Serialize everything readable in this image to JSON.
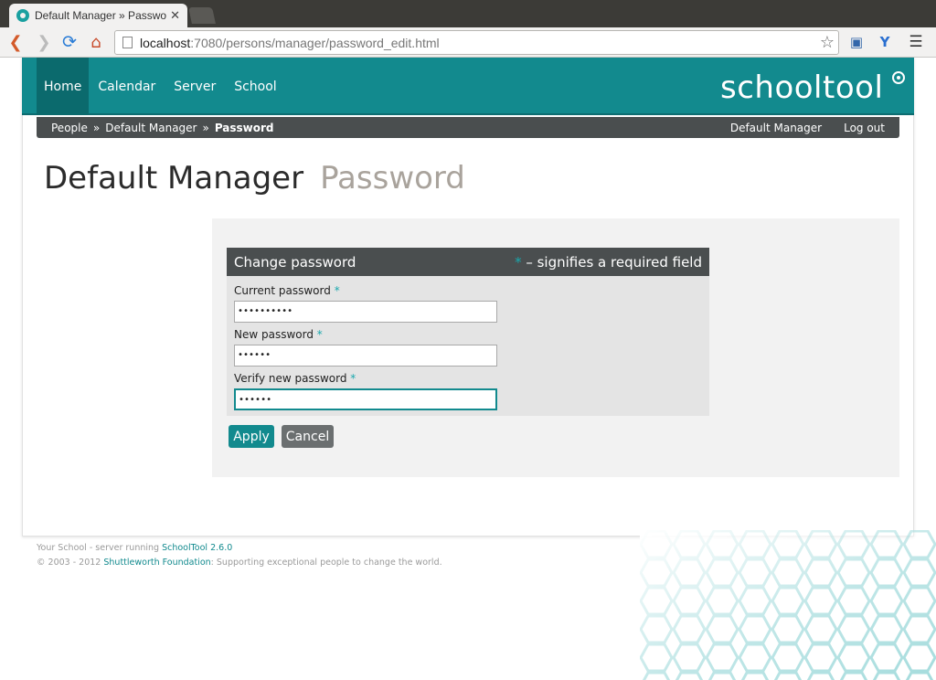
{
  "browser": {
    "tab_title": "Default Manager » Passwo",
    "url_host": "localhost",
    "url_path": ":7080/persons/manager/password_edit.html"
  },
  "header": {
    "nav": [
      "Home",
      "Calendar",
      "Server",
      "School"
    ],
    "logo": "schooltool"
  },
  "breadcrumb": {
    "items": [
      "People",
      "Default Manager"
    ],
    "current": "Password",
    "separator": "»"
  },
  "user": {
    "name": "Default Manager",
    "logout": "Log out"
  },
  "page": {
    "title": "Default Manager",
    "subtitle": "Password"
  },
  "form": {
    "legend": "Change password",
    "required_star": "*",
    "required_hint": " – signifies a required field",
    "fields": [
      {
        "label": "Current password",
        "value": "••••••••••"
      },
      {
        "label": "New password",
        "value": "••••••"
      },
      {
        "label": "Verify new password",
        "value": "••••••"
      }
    ],
    "apply": "Apply",
    "cancel": "Cancel"
  },
  "footer": {
    "line1_prefix": "Your School - server running ",
    "line1_link": "SchoolTool 2.6.0",
    "line2_prefix": "© 2003 - 2012 ",
    "line2_link": "Shuttleworth Foundation",
    "line2_suffix": ": Supporting exceptional people to change the world."
  },
  "colors": {
    "accent": "#128a8e",
    "dark_bar": "#4a4e4f"
  }
}
